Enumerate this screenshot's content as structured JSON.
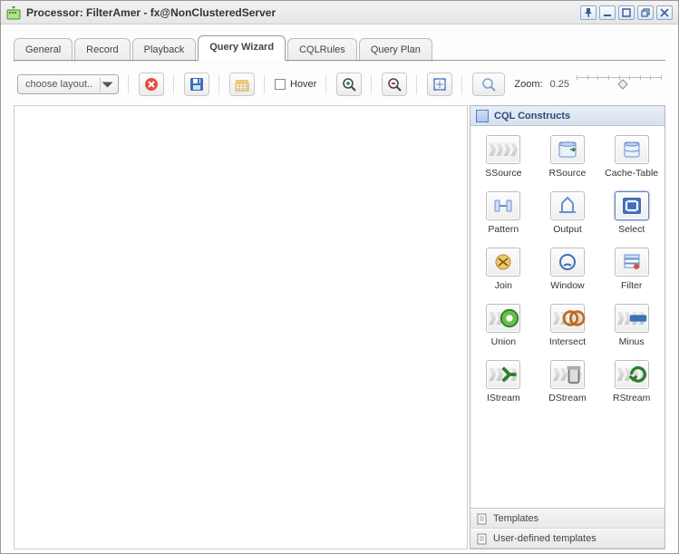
{
  "window": {
    "title": "Processor: FilterAmer - fx@NonClusteredServer"
  },
  "tabs": [
    {
      "label": "General",
      "active": false
    },
    {
      "label": "Record",
      "active": false
    },
    {
      "label": "Playback",
      "active": false
    },
    {
      "label": "Query Wizard",
      "active": true
    },
    {
      "label": "CQLRules",
      "active": false
    },
    {
      "label": "Query Plan",
      "active": false
    }
  ],
  "toolbar": {
    "layout_placeholder": "choose layout..",
    "hover_label": "Hover",
    "zoom_label": "Zoom:",
    "zoom_value": "0.25"
  },
  "palette": {
    "header": "CQL Constructs",
    "items": [
      {
        "label": "SSource"
      },
      {
        "label": "RSource"
      },
      {
        "label": "Cache-Table"
      },
      {
        "label": "Pattern"
      },
      {
        "label": "Output"
      },
      {
        "label": "Select"
      },
      {
        "label": "Join"
      },
      {
        "label": "Window"
      },
      {
        "label": "Filter"
      },
      {
        "label": "Union"
      },
      {
        "label": "Intersect"
      },
      {
        "label": "Minus"
      },
      {
        "label": "IStream"
      },
      {
        "label": "DStream"
      },
      {
        "label": "RStream"
      }
    ],
    "footer": {
      "templates": "Templates",
      "user_templates": "User-defined templates"
    }
  }
}
